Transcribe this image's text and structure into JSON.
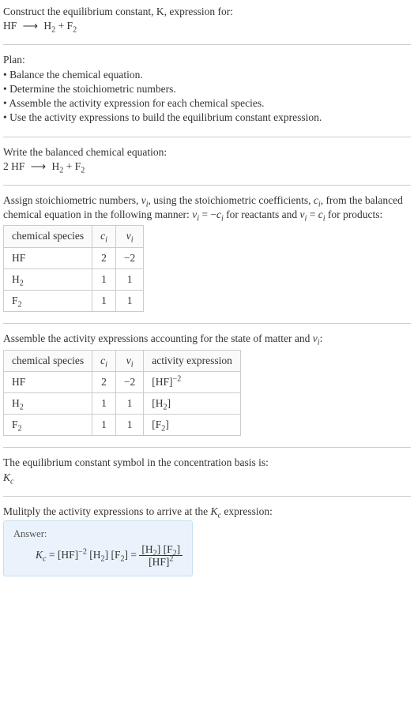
{
  "header": {
    "prompt": "Construct the equilibrium constant, K, expression for:",
    "equation_html": "HF <span class='arrow'>⟶</span> H<sub>2</sub> + F<sub>2</sub>"
  },
  "plan": {
    "title": "Plan:",
    "items": [
      "• Balance the chemical equation.",
      "• Determine the stoichiometric numbers.",
      "• Assemble the activity expression for each chemical species.",
      "• Use the activity expressions to build the equilibrium constant expression."
    ]
  },
  "balanced": {
    "intro": "Write the balanced chemical equation:",
    "equation_html": "2 HF <span class='arrow'>⟶</span> H<sub>2</sub> + F<sub>2</sub>"
  },
  "stoich": {
    "intro_html": "Assign stoichiometric numbers, <i>ν<sub>i</sub></i>, using the stoichiometric coefficients, <i>c<sub>i</sub></i>, from the balanced chemical equation in the following manner: <i>ν<sub>i</sub></i> = −<i>c<sub>i</sub></i> for reactants and <i>ν<sub>i</sub></i> = <i>c<sub>i</sub></i> for products:",
    "headers": {
      "species": "chemical species",
      "ci_html": "<i>c<sub>i</sub></i>",
      "vi_html": "<i>ν<sub>i</sub></i>"
    },
    "rows": [
      {
        "species_html": "HF",
        "ci": "2",
        "vi": "−2"
      },
      {
        "species_html": "H<sub>2</sub>",
        "ci": "1",
        "vi": "1"
      },
      {
        "species_html": "F<sub>2</sub>",
        "ci": "1",
        "vi": "1"
      }
    ]
  },
  "activity": {
    "intro_html": "Assemble the activity expressions accounting for the state of matter and <i>ν<sub>i</sub></i>:",
    "headers": {
      "species": "chemical species",
      "ci_html": "<i>c<sub>i</sub></i>",
      "vi_html": "<i>ν<sub>i</sub></i>",
      "act": "activity expression"
    },
    "rows": [
      {
        "species_html": "HF",
        "ci": "2",
        "vi": "−2",
        "act_html": "[HF]<sup>−2</sup>"
      },
      {
        "species_html": "H<sub>2</sub>",
        "ci": "1",
        "vi": "1",
        "act_html": "[H<sub>2</sub>]"
      },
      {
        "species_html": "F<sub>2</sub>",
        "ci": "1",
        "vi": "1",
        "act_html": "[F<sub>2</sub>]"
      }
    ]
  },
  "kc_basis": {
    "intro": "The equilibrium constant symbol in the concentration basis is:",
    "symbol_html": "<i>K<sub>c</sub></i>"
  },
  "multiply": {
    "intro_html": "Mulitply the activity expressions to arrive at the <i>K<sub>c</sub></i> expression:"
  },
  "answer": {
    "label": "Answer:",
    "lhs_html": "<i>K<sub>c</sub></i> = [HF]<sup>−2</sup> [H<sub>2</sub>] [F<sub>2</sub>] = ",
    "frac_num_html": "[H<sub>2</sub>] [F<sub>2</sub>]",
    "frac_den_html": "[HF]<sup>2</sup>"
  }
}
